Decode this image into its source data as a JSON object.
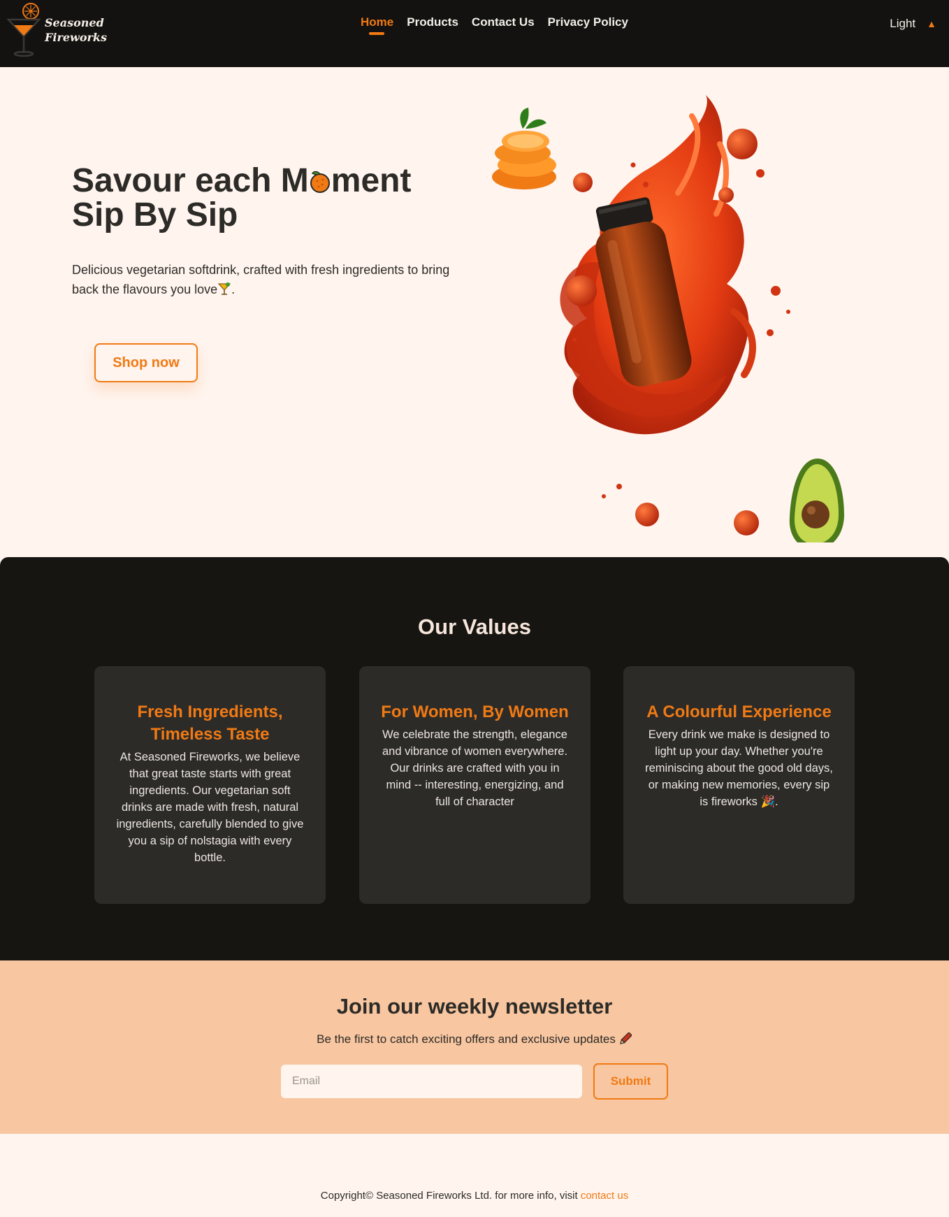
{
  "brand": {
    "line1": "Seasoned",
    "line2": "Fireworks"
  },
  "nav": {
    "items": [
      {
        "label": "Home",
        "active": true
      },
      {
        "label": "Products",
        "active": false
      },
      {
        "label": "Contact Us",
        "active": false
      },
      {
        "label": "Privacy Policy",
        "active": false
      }
    ],
    "theme_label": "Light",
    "theme_caret": "▲"
  },
  "hero": {
    "title_part1": "Savour each M",
    "title_part2": "ment",
    "title_line2": "Sip By Sip",
    "description": "Delicious vegetarian softdrink, crafted with fresh ingredients to bring back the flavours you love",
    "description_end": ".",
    "shop_button": "Shop now"
  },
  "values": {
    "title": "Our Values",
    "cards": [
      {
        "title": "Fresh Ingredients, Timeless Taste",
        "text": "At Seasoned Fireworks, we believe that great taste starts with great ingredients. Our vegetarian soft drinks are made with fresh, natural ingredients, carefully blended to give you a sip of nolstagia with every bottle."
      },
      {
        "title": "For Women, By Women",
        "text": "We celebrate the strength, elegance and vibrance of women everywhere. Our drinks are crafted with you in mind -- interesting, energizing, and full of character"
      },
      {
        "title": "A Colourful Experience",
        "text": "Every drink we make is designed to light up your day. Whether you're reminiscing about the good old days, or making new memories, every sip is fireworks 🎉."
      }
    ]
  },
  "newsletter": {
    "title": "Join our weekly newsletter",
    "subtitle": "Be the first to catch exciting offers and exclusive updates",
    "email_placeholder": "Email",
    "submit_label": "Submit"
  },
  "footer": {
    "text": "Copyright© Seasoned Fireworks Ltd. for more info, visit",
    "link": "contact us"
  },
  "colors": {
    "accent": "#f07a14",
    "dark": "#141210",
    "cream": "#fff4ee",
    "peach": "#f8c6a0",
    "card": "#2d2b28"
  },
  "icons": [
    "cocktail-glass-logo-icon",
    "orange-icon",
    "cocktail-icon",
    "pen-icon",
    "party-popper-icon",
    "caret-up-icon"
  ]
}
